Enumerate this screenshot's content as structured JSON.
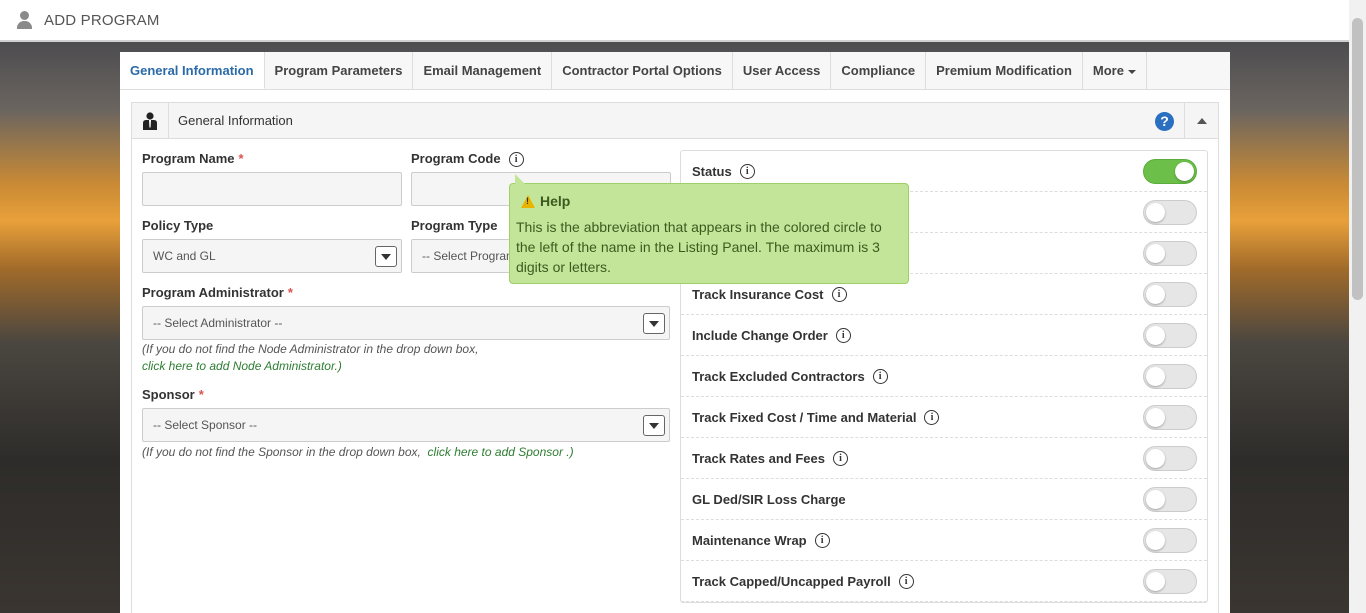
{
  "header": {
    "title": "ADD PROGRAM"
  },
  "tabs": [
    {
      "label": "General Information"
    },
    {
      "label": "Program Parameters"
    },
    {
      "label": "Email Management"
    },
    {
      "label": "Contractor Portal Options"
    },
    {
      "label": "User Access"
    },
    {
      "label": "Compliance"
    },
    {
      "label": "Premium Modification"
    },
    {
      "label": "More"
    }
  ],
  "panel": {
    "title": "General Information",
    "help": "?"
  },
  "form": {
    "program_name_label": "Program Name",
    "program_code_label": "Program Code",
    "policy_type_label": "Policy Type",
    "policy_type_value": "WC and GL",
    "program_type_label": "Program Type",
    "program_type_value": "-- Select Program Type --",
    "admin_label": "Program Administrator",
    "admin_value": "-- Select Administrator --",
    "admin_note": "(If you do not find the Node Administrator in the drop down box,",
    "admin_link": "click here to add Node Administrator.)",
    "sponsor_label": "Sponsor",
    "sponsor_value": "-- Select Sponsor --",
    "sponsor_note": "(If you do not find the Sponsor in the drop down box,",
    "sponsor_link": "click here to add Sponsor .)",
    "sponsor_note_end": ""
  },
  "settings": [
    {
      "label": "Status",
      "info": true,
      "on": true
    },
    {
      "label": "",
      "info": false,
      "on": false
    },
    {
      "label": "",
      "info": false,
      "on": false
    },
    {
      "label": "Track Insurance Cost",
      "info": true,
      "on": false
    },
    {
      "label": "Include Change Order",
      "info": true,
      "on": false
    },
    {
      "label": "Track Excluded Contractors",
      "info": true,
      "on": false
    },
    {
      "label": "Track Fixed Cost / Time and Material",
      "info": true,
      "on": false
    },
    {
      "label": "Track Rates and Fees",
      "info": true,
      "on": false
    },
    {
      "label": "GL Ded/SIR Loss Charge",
      "info": false,
      "on": false
    },
    {
      "label": "Maintenance Wrap",
      "info": true,
      "on": false
    },
    {
      "label": "Track Capped/Uncapped Payroll",
      "info": true,
      "on": false
    }
  ],
  "tooltip": {
    "title": "Help",
    "body": "This is the abbreviation that appears in the colored circle to the left of the name in the Listing Panel. The maximum is 3 digits or letters."
  },
  "colors": {
    "active_tab": "#2a6aa8",
    "toggle_on": "#6cc04a",
    "tooltip_bg": "#c3e59a",
    "required": "#d9534f",
    "link": "#2e7d32"
  }
}
